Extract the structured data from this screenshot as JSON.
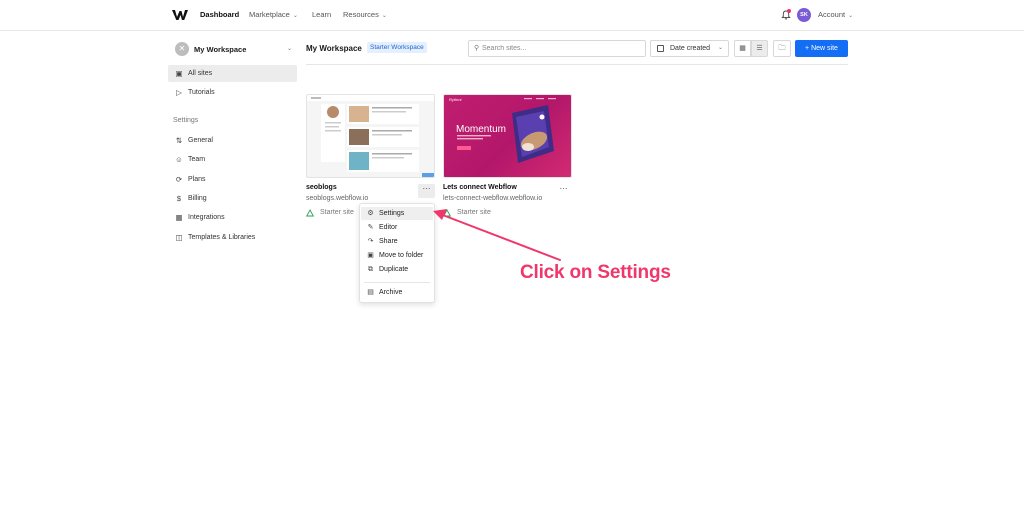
{
  "topnav": {
    "items": [
      {
        "label": "Dashboard",
        "active": true
      },
      {
        "label": "Marketplace",
        "has_menu": true
      },
      {
        "label": "Learn"
      },
      {
        "label": "Resources",
        "has_menu": true
      }
    ],
    "avatar_initials": "SK",
    "account_label": "Account",
    "notification_color": "#e8356d",
    "avatar_color": "#7b5bd6"
  },
  "sidebar": {
    "workspace_name": "My Workspace",
    "items": [
      {
        "label": "All sites",
        "icon": "folder-icon",
        "active": true
      },
      {
        "label": "Tutorials",
        "icon": "video-icon"
      }
    ],
    "settings_heading": "Settings",
    "settings_items": [
      {
        "label": "General",
        "icon": "sliders-icon"
      },
      {
        "label": "Team",
        "icon": "team-icon"
      },
      {
        "label": "Plans",
        "icon": "plans-icon"
      },
      {
        "label": "Billing",
        "icon": "dollar-icon"
      },
      {
        "label": "Integrations",
        "icon": "integrations-icon"
      },
      {
        "label": "Templates & Libraries",
        "icon": "book-icon"
      }
    ]
  },
  "main": {
    "title": "My Workspace",
    "badge": "Starter Workspace",
    "search_placeholder": "Search sites...",
    "sort_label": "Date created",
    "new_site_label": "New site",
    "accent_color": "#146ef5"
  },
  "sites": [
    {
      "name": "seoblogs",
      "url": "seoblogs.webflow.io",
      "plan": "Starter site"
    },
    {
      "name": "Lets connect Webflow",
      "url": "lets-connect-webflow.webflow.io",
      "plan": "Starter site",
      "thumbnail_title": "Momentum"
    }
  ],
  "site_menu": {
    "items": [
      {
        "label": "Settings",
        "icon": "gear-icon",
        "highlighted": true
      },
      {
        "label": "Editor",
        "icon": "pencil-icon"
      },
      {
        "label": "Share",
        "icon": "share-icon"
      },
      {
        "label": "Move to folder",
        "icon": "folder-icon"
      },
      {
        "label": "Duplicate",
        "icon": "duplicate-icon"
      },
      {
        "label": "Archive",
        "icon": "archive-icon"
      }
    ]
  },
  "annotation": {
    "text": "Click on Settings",
    "color": "#f0376b"
  }
}
